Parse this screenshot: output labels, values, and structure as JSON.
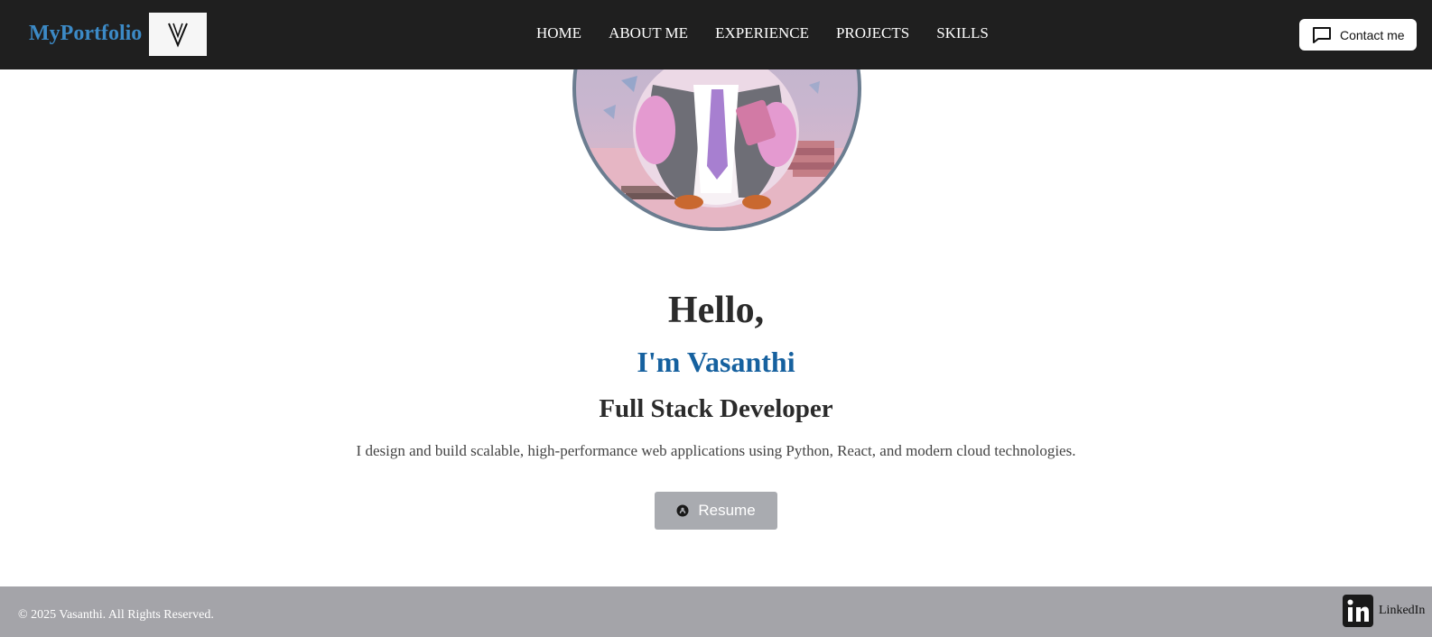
{
  "navbar": {
    "brand": "MyPortfolio",
    "logo_icon": "v-monogram-icon",
    "links": [
      {
        "label": "HOME"
      },
      {
        "label": "ABOUT ME"
      },
      {
        "label": "EXPERIENCE"
      },
      {
        "label": "PROJECTS"
      },
      {
        "label": "SKILLS"
      }
    ],
    "contact_label": "Contact me",
    "contact_icon": "chat-bubble-icon"
  },
  "hero": {
    "avatar_icon": "penguin-avatar-image",
    "greeting": "Hello,",
    "name": "I'm Vasanthi",
    "role": "Full Stack Developer",
    "tagline": "I design and build scalable, high-performance web applications using Python, React, and modern cloud technologies.",
    "resume_label": "Resume",
    "resume_icon": "github-icon"
  },
  "footer": {
    "copyright": "© 2025 Vasanthi. All Rights Reserved.",
    "linkedin_label": "LinkedIn",
    "linkedin_icon": "linkedin-icon"
  },
  "colors": {
    "navbar_bg": "#1f1f1f",
    "brand": "#3c8ac6",
    "name": "#16619f",
    "resume_bg": "#a9abb0",
    "footer_bg": "#a4a4a9",
    "avatar_border": "#6b7d90"
  }
}
